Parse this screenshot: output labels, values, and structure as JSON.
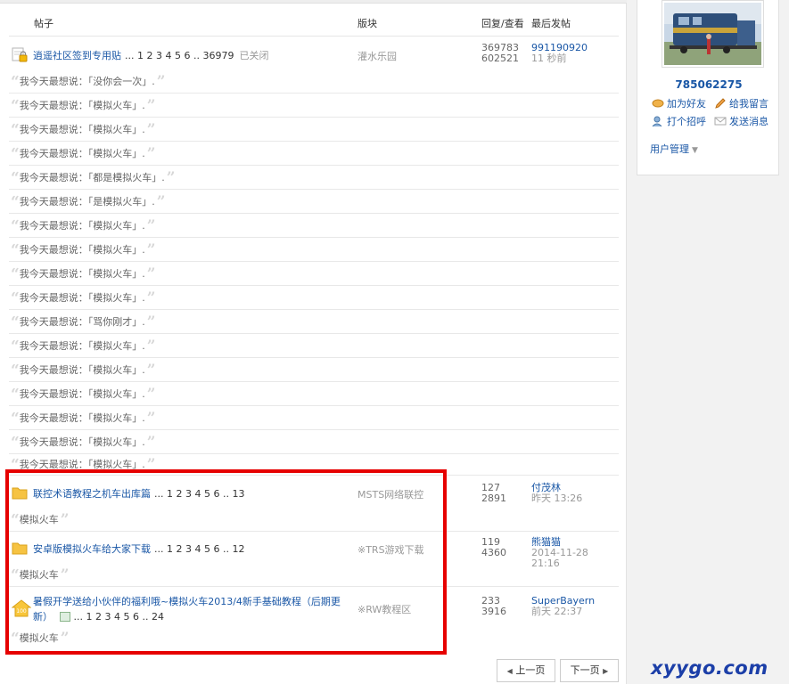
{
  "header": {
    "col_topic": "帖子",
    "col_forum": "版块",
    "col_stats": "回复/查看",
    "col_last": "最后发帖"
  },
  "sticky": {
    "title": "逍遥社区签到专用贴",
    "pages": "... 1 2 3 4 5 6 .. 36979",
    "status": "已关闭",
    "forum": "灌水乐园",
    "replies": "369783",
    "views": "602521",
    "last_user": "991190920",
    "last_time": "11 秒前"
  },
  "quotes": [
    "我今天最想说：「没你会一次」.",
    "我今天最想说：「模拟火车」.",
    "我今天最想说：「模拟火车」.",
    "我今天最想说：「模拟火车」.",
    "我今天最想说：「都是模拟火车」.",
    "我今天最想说：「是模拟火车」.",
    "我今天最想说：「模拟火车」.",
    "我今天最想说：「模拟火车」.",
    "我今天最想说：「模拟火车」.",
    "我今天最想说：「模拟火车」.",
    "我今天最想说：「骂你刚才」.",
    "我今天最想说：「模拟火车」.",
    "我今天最想说：「模拟火车」.",
    "我今天最想说：「模拟火车」.",
    "我今天最想说：「模拟火车」.",
    "我今天最想说：「模拟火车」.",
    "我今天最想说：「模拟火车」."
  ],
  "threads": [
    {
      "title": "联控术语教程之机车出库篇",
      "pages": "... 1 2 3 4 5 6 .. 13",
      "forum": "MSTS网络联控",
      "replies": "127",
      "views": "2891",
      "last_user": "付茂林",
      "last_time": "昨天 13:26",
      "quote": "模拟火车"
    },
    {
      "title": "安卓版模拟火车给大家下载",
      "pages": "... 1 2 3 4 5 6 .. 12",
      "forum": "※TRS游戏下载",
      "replies": "119",
      "views": "4360",
      "last_user": "熊猫猫",
      "last_time": "2014-11-28 21:16",
      "quote": "模拟火车"
    },
    {
      "title_line1": "暑假开学送给小伙伴的福利哦~模拟火车2013/4新手基础教程（后期更",
      "title_line2": "新）",
      "pages": "... 1 2 3 4 5 6 .. 24",
      "forum": "※RW教程区",
      "replies": "233",
      "views": "3916",
      "last_user": "SuperBayern",
      "last_time": "前天 22:37",
      "quote": "模拟火车"
    }
  ],
  "pager": {
    "prev": "上一页",
    "next": "下一页"
  },
  "profile": {
    "username": "785062275",
    "add_friend": "加为好友",
    "leave_message": "给我留言",
    "greet": "打个招呼",
    "send_message": "发送消息",
    "user_manage": "用户管理"
  },
  "watermark": "xyygo.com",
  "colors": {
    "link": "#1a57a6",
    "highlight_box": "#e60000",
    "watermark": "#1c3fa8"
  }
}
